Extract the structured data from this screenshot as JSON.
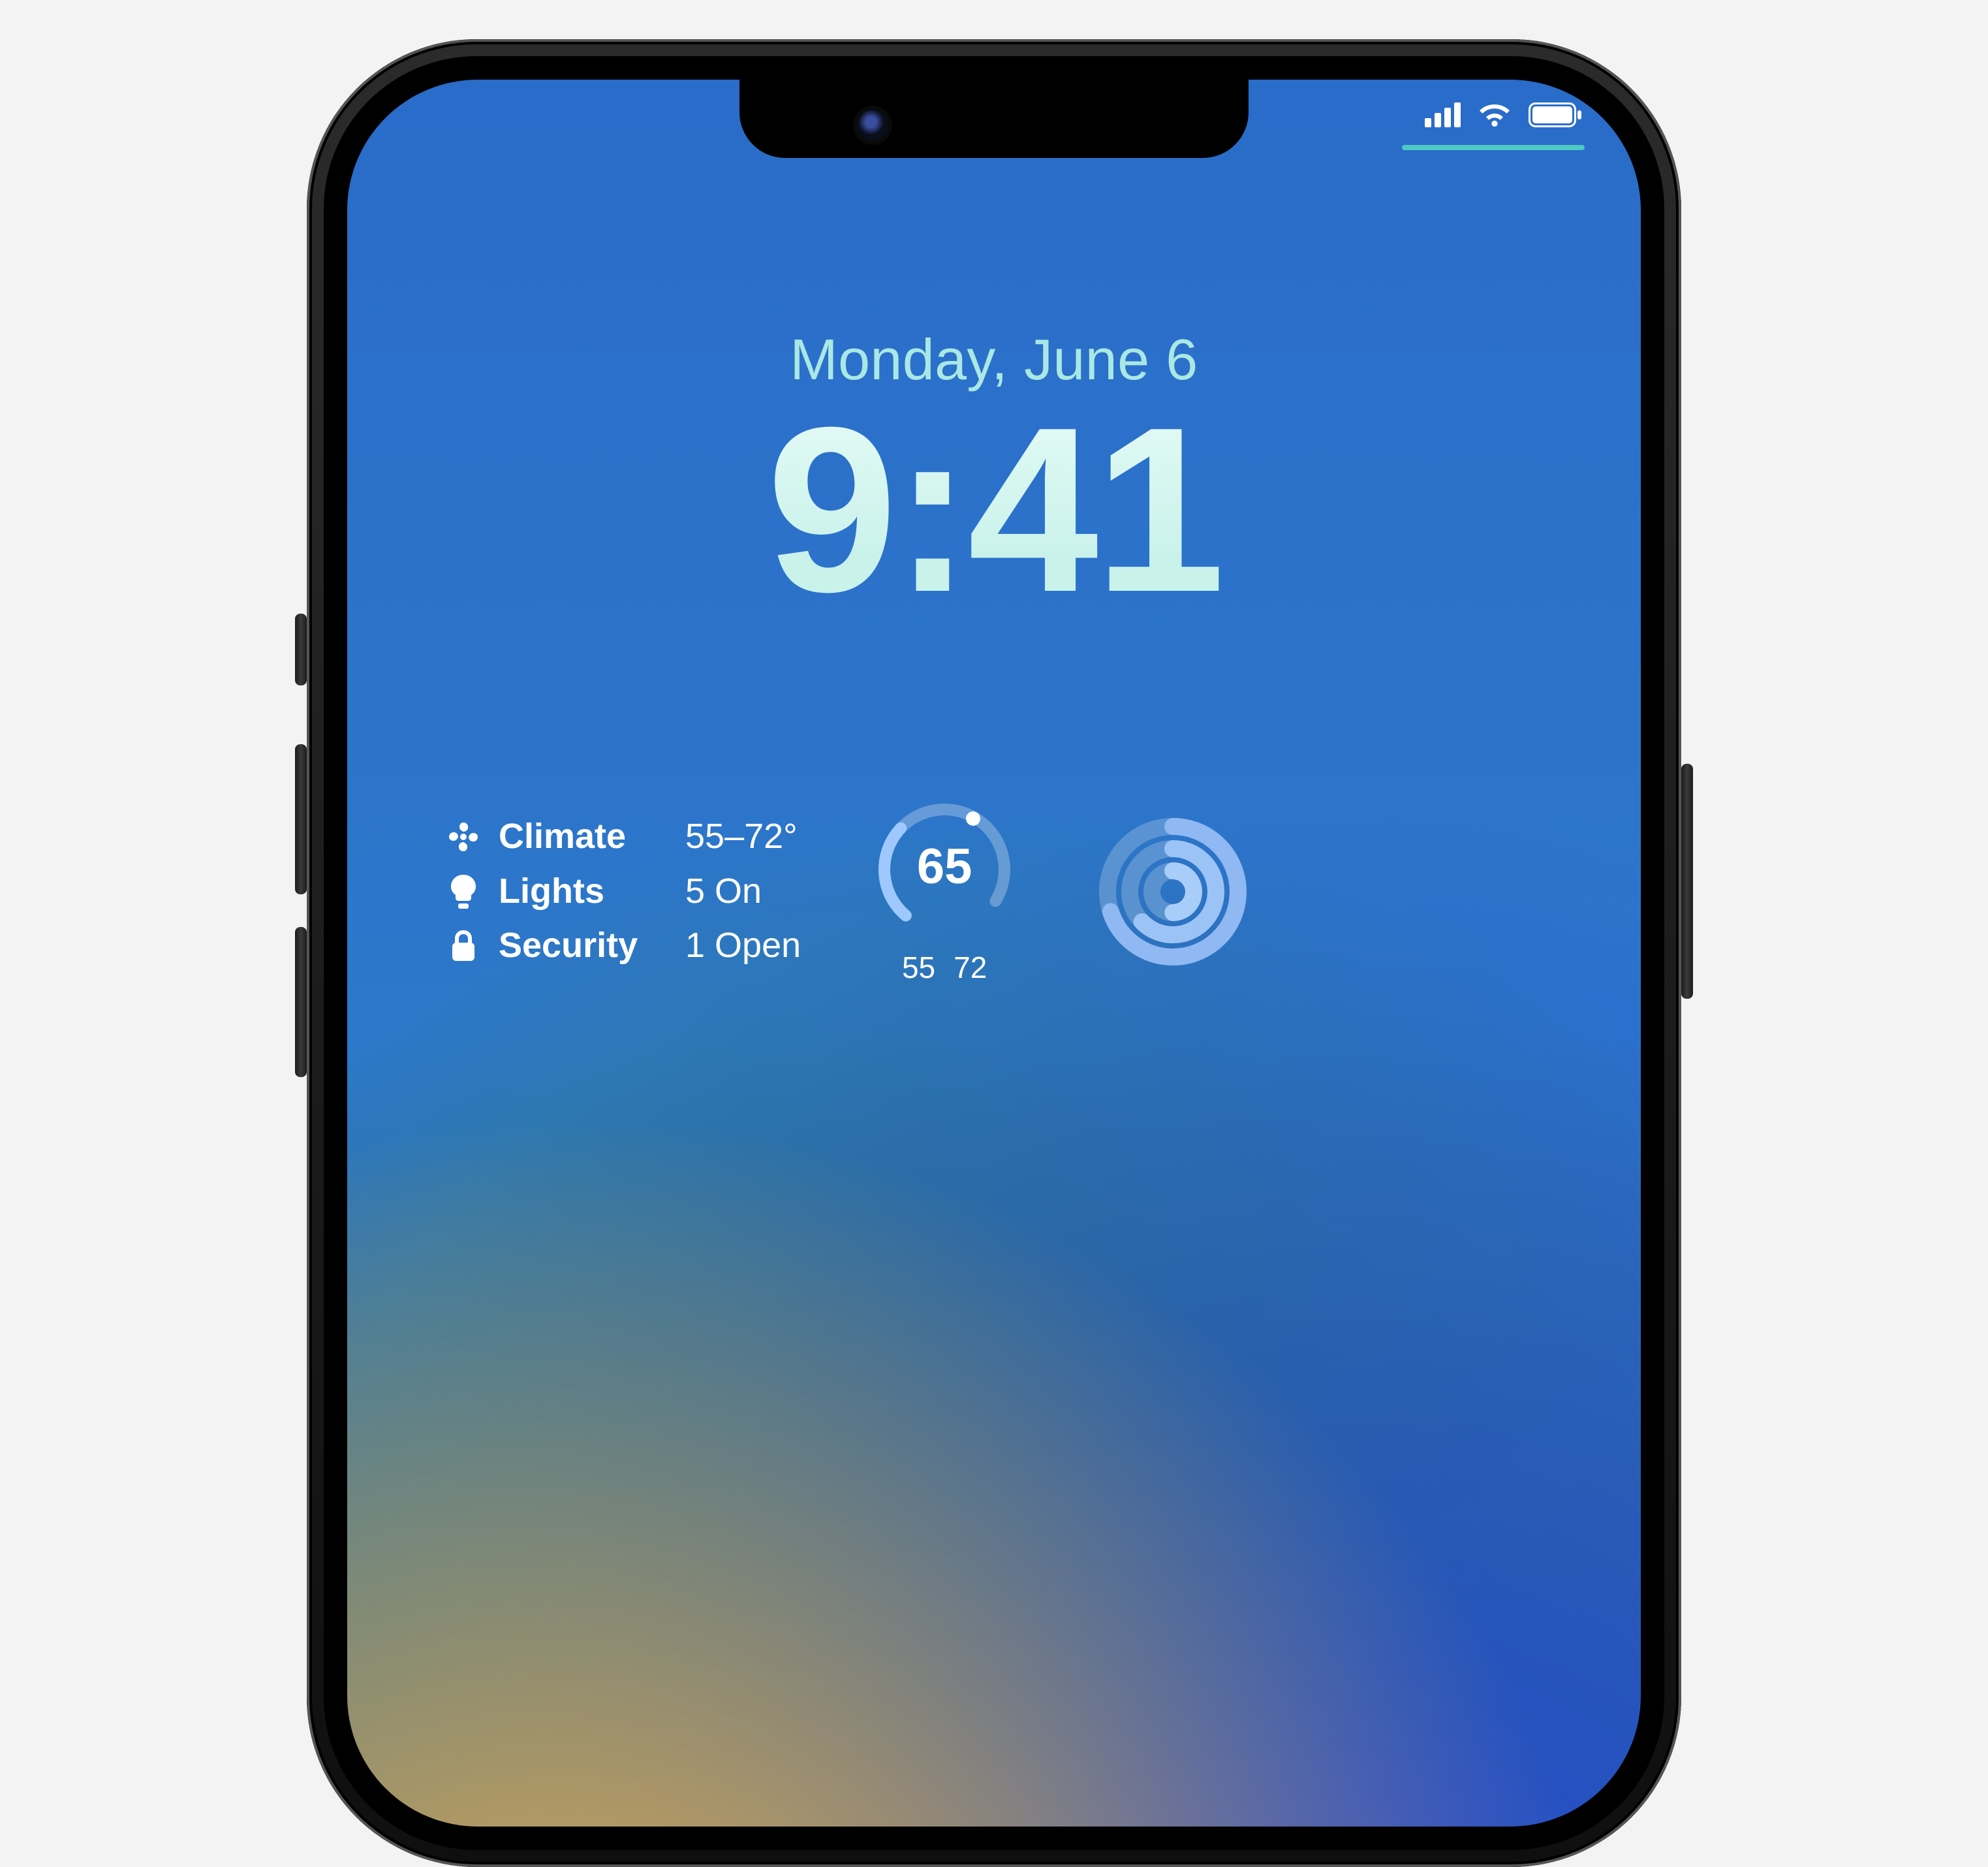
{
  "status": {
    "cellular_bars": 4,
    "wifi_strength": 3,
    "battery_pct": 100
  },
  "lock": {
    "date": "Monday, June 6",
    "time": "9:41"
  },
  "home_widget": {
    "rows": [
      {
        "icon": "fan-icon",
        "label": "Climate",
        "value": "55–72°"
      },
      {
        "icon": "bulb-icon",
        "label": "Lights",
        "value": "5 On"
      },
      {
        "icon": "lock-icon",
        "label": "Security",
        "value": "1 Open"
      }
    ]
  },
  "weather_widget": {
    "current": "65",
    "low": "55",
    "high": "72"
  }
}
